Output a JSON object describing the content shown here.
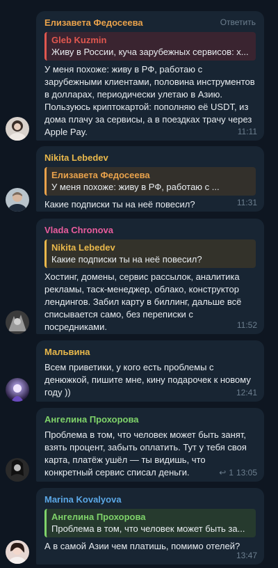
{
  "colors": {
    "background": "#0e1621",
    "bubble": "#182533",
    "text": "#e9edf1",
    "meta": "#6d7f8f"
  },
  "messages": [
    {
      "sender": "Елизавета Федосеева",
      "sender_color": "#e9a24b",
      "action": "Ответить",
      "reply": {
        "name": "Gleb Kuzmin",
        "text": "Живу в России, куча зарубежных сервисов: х...",
        "color": "#e0574f",
        "bg": "#3a2430"
      },
      "text": "У меня похоже: живу в РФ, работаю с зарубежными клиентами, половина инструментов в долларах, периодически улетаю в Азию. Пользуюсь криптокартой: пополняю её USDT, из дома плачу за сервисы, а в поездках трачу через Apple Pay.",
      "time": "11:11"
    },
    {
      "sender": "Nikita Lebedev",
      "sender_color": "#e9b84b",
      "reply": {
        "name": "Елизавета Федосеева",
        "text": "У меня похоже: живу в РФ, работаю с ...",
        "color": "#e9a24b",
        "bg": "#33302b"
      },
      "text": "Какие подписки ты на неё повесил?",
      "time": "11:31"
    },
    {
      "sender": "Vlada Chronova",
      "sender_color": "#e95c9d",
      "reply": {
        "name": "Nikita Lebedev",
        "text": "Какие подписки ты на неё повесил?",
        "color": "#e9b84b",
        "bg": "#33322a"
      },
      "text": "Хостинг, домены, сервис рассылок, аналитика рекламы, таск-менеджер, облако, конструктор лендингов. Забил карту в биллинг, дальше всё списывается само, без переписки с посредниками.",
      "time": "11:52"
    },
    {
      "sender": "Мальвина",
      "sender_color": "#e9b84b",
      "text": "Всем приветики, у кого есть проблемы с денюжкой, пишите мне, кину подарочек к новому году ))",
      "time": "12:41"
    },
    {
      "sender": "Ангелина Прохорова",
      "sender_color": "#7fd36a",
      "text": "Проблема в том, что человек может быть занят, взять процент, забыть оплатить. Тут у тебя своя карта, платёж ушёл — ты видишь, что конкретный сервис списал деньги.",
      "replies": "1",
      "time": "13:05"
    },
    {
      "sender": "Marina Kovalyova",
      "sender_color": "#5ba7e6",
      "reply": {
        "name": "Ангелина Прохорова",
        "text": "Проблема в том, что человек может быть за...",
        "color": "#7fd36a",
        "bg": "#263a2e"
      },
      "text": "А в самой Азии чем платишь, помимо отелей?",
      "time": "13:47"
    }
  ]
}
